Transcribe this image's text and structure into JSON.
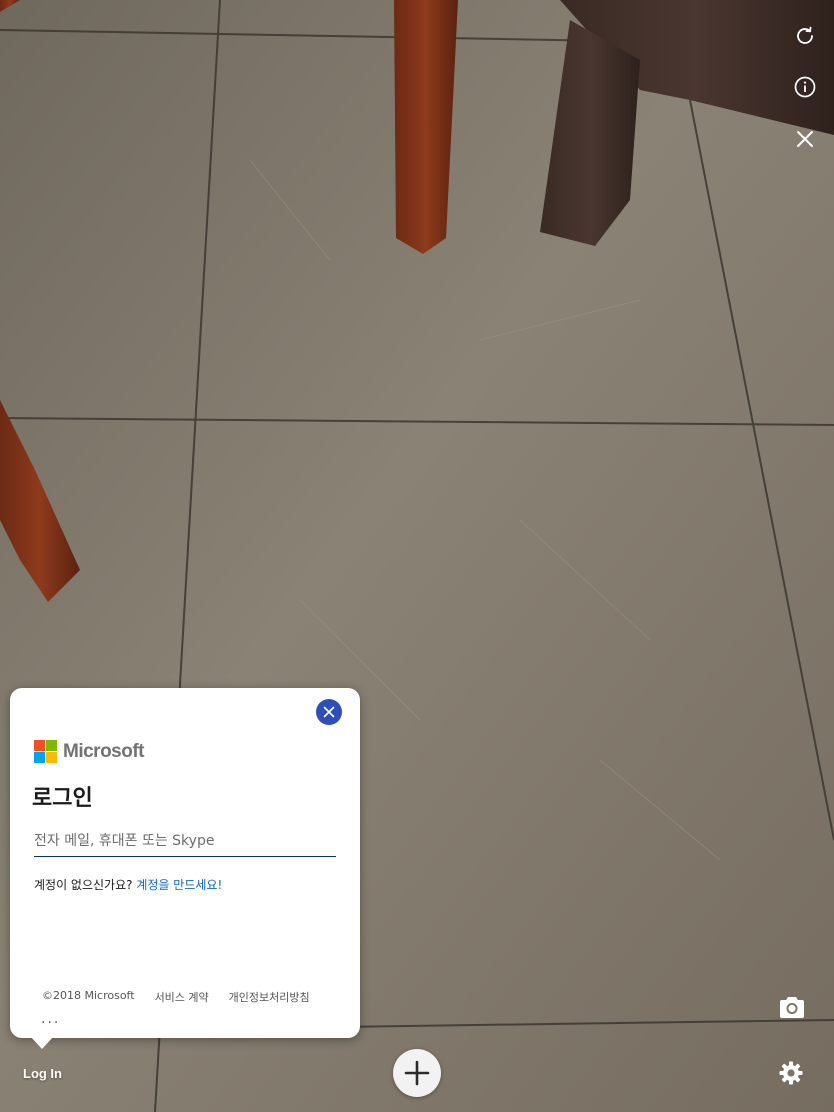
{
  "toolbar": {
    "refresh_icon": "refresh-icon",
    "info_icon": "info-icon",
    "close_icon": "close-icon",
    "camera_icon": "camera-icon",
    "settings_icon": "gear-icon",
    "add_icon": "plus-icon"
  },
  "signin": {
    "brand": "Microsoft",
    "title": "로그인",
    "email_placeholder": "전자 메일, 휴대폰 또는 Skype",
    "no_account_text": "계정이 없으신가요?",
    "create_account_link": "계정을 만드세요!",
    "footer": {
      "copyright": "©2018 Microsoft",
      "terms": "서비스 계약",
      "privacy": "개인정보처리방침",
      "more": "..."
    }
  },
  "bottom_bar": {
    "login_label": "Log In"
  },
  "colors": {
    "ms_red": "#f25022",
    "ms_green": "#7fba00",
    "ms_blue": "#00a4ef",
    "ms_yellow": "#ffb900",
    "close_button": "#2e4eb8",
    "link": "#0f67c6"
  }
}
